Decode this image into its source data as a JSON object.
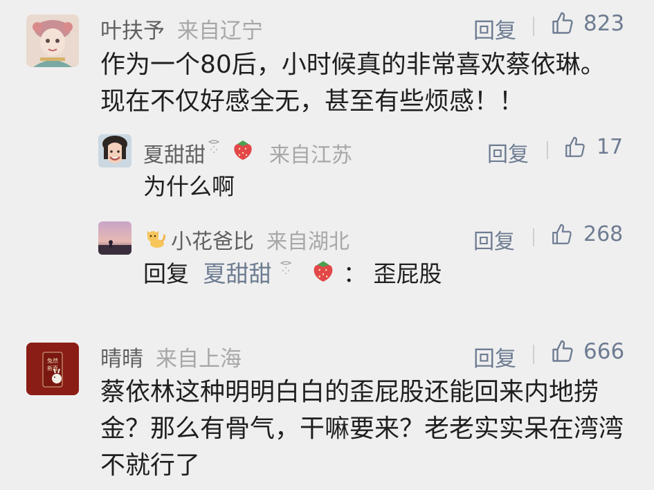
{
  "comments": [
    {
      "username": "叶扶予",
      "location": "来自辽宁",
      "reply_label": "回复",
      "likes": "823",
      "text": "作为一个80后，小时候真的非常喜欢蔡依琳。现在不仅好感全无，甚至有些烦感！！",
      "replies": [
        {
          "username": "夏甜甜",
          "location": "来自江苏",
          "reply_label": "回复",
          "likes": "17",
          "text": "为什么啊",
          "badge": "strawberry-icon"
        },
        {
          "username": "小花爸比",
          "location": "来自湖北",
          "reply_label": "回复",
          "likes": "268",
          "reply_prefix": "回复",
          "reply_to": "夏甜甜",
          "separator": "：",
          "text": "歪屁股",
          "badge": "cat-icon"
        }
      ]
    },
    {
      "username": "晴晴",
      "location": "来自上海",
      "reply_label": "回复",
      "likes": "666",
      "text": "蔡依林这种明明白白的歪屁股还能回来内地捞金？那么有骨气，干嘛要来？老老实实呆在湾湾不就行了",
      "avatar_text": "兔然新喜"
    }
  ],
  "colors": {
    "background": "#efefef",
    "username": "#5f5f5f",
    "location": "#a7a7a7",
    "action": "#6e7c92",
    "text": "#1f1f1f"
  }
}
